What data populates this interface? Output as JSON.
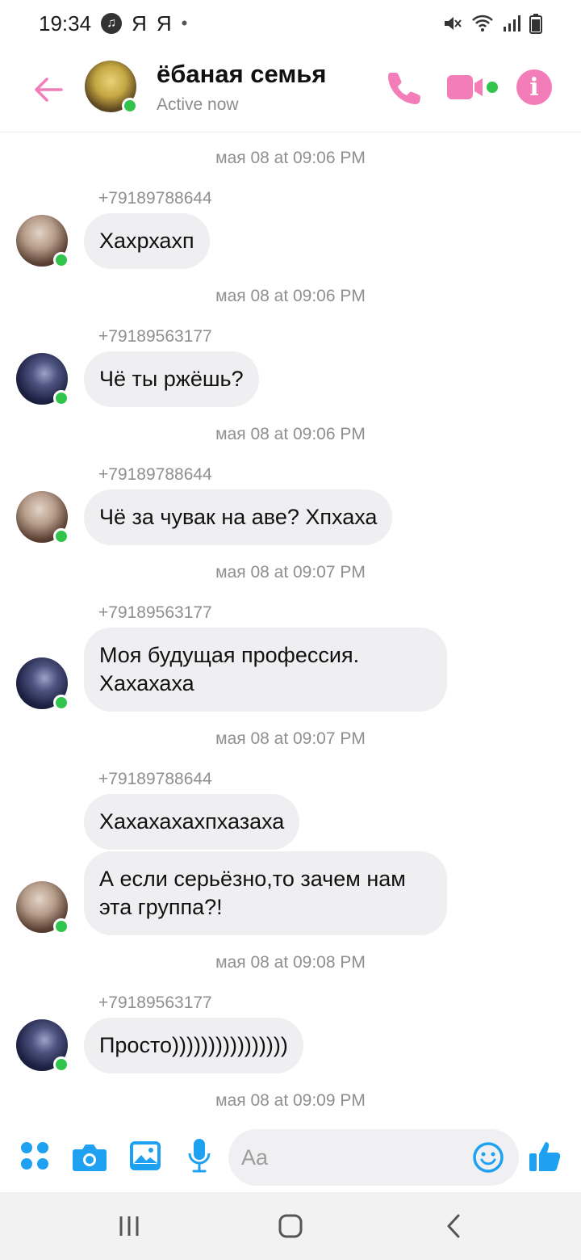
{
  "status_bar": {
    "time": "19:34",
    "notif_1": "Я",
    "notif_2": "Я",
    "dot": "•"
  },
  "header": {
    "title": "ёбаная семья",
    "subtitle": "Active now"
  },
  "messages": [
    {
      "timestamp": "мая 08 at 09:06 PM",
      "sender": "+79189788644",
      "bubbles": [
        "Хахрхахп"
      ]
    },
    {
      "timestamp": "мая 08 at 09:06 PM",
      "sender": "+79189563177",
      "bubbles": [
        "Чё ты ржёшь?"
      ]
    },
    {
      "timestamp": "мая 08 at 09:06 PM",
      "sender": "+79189788644",
      "bubbles": [
        "Чё за чувак на аве? Хпхаха"
      ]
    },
    {
      "timestamp": "мая 08 at 09:07 PM",
      "sender": "+79189563177",
      "bubbles": [
        "Моя будущая профессия. Хахахаха"
      ]
    },
    {
      "timestamp": "мая 08 at 09:07 PM",
      "sender": "+79189788644",
      "bubbles": [
        "Хахахахахпхазаха",
        "А если серьёзно,то зачем нам эта группа?!"
      ]
    },
    {
      "timestamp": "мая 08 at 09:08 PM",
      "sender": "+79189563177",
      "bubbles": [
        "Просто))))))))))))))))"
      ]
    },
    {
      "timestamp": "мая 08 at 09:09 PM"
    }
  ],
  "composer": {
    "placeholder": "Aa"
  },
  "colors": {
    "accent_pink": "#f37db8",
    "accent_blue": "#1ea1f1",
    "online_green": "#31c44d",
    "bubble_gray": "#efeef1"
  },
  "icons": [
    "back-arrow-icon",
    "phone-icon",
    "video-camera-icon",
    "info-icon",
    "apps-grid-icon",
    "camera-icon",
    "gallery-icon",
    "microphone-icon",
    "emoji-icon",
    "thumbs-up-icon",
    "recent-apps-icon",
    "home-icon",
    "nav-back-icon"
  ]
}
